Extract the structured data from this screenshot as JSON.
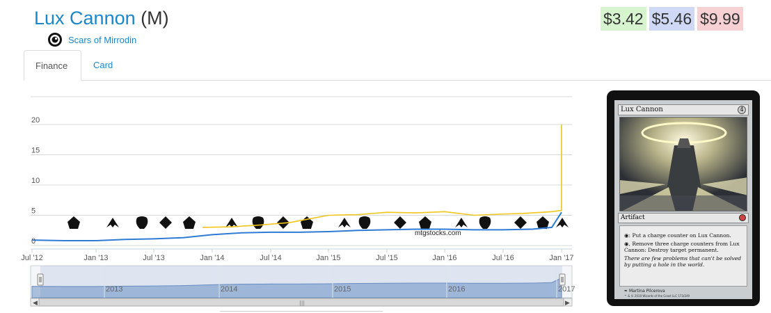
{
  "header": {
    "card_name": "Lux Cannon",
    "rarity": "(M)",
    "set_name": "Scars of Mirrodin",
    "set_icon": "scars-of-mirrodin-symbol"
  },
  "prices": {
    "low": "$3.42",
    "avg": "$5.46",
    "high": "$9.99",
    "colors": {
      "low": "#d6f5cf",
      "avg": "#cfd9f5",
      "high": "#f6d0d2"
    }
  },
  "tabs": [
    {
      "label": "Finance",
      "active": true
    },
    {
      "label": "Card",
      "active": false
    }
  ],
  "chart_data": {
    "type": "line",
    "title": "",
    "xlabel": "",
    "ylabel": "",
    "ylim": [
      0,
      25
    ],
    "yticks": [
      "0",
      "5",
      "10",
      "15",
      "20"
    ],
    "xticks": [
      "Jul '12",
      "Jan '13",
      "Jul '13",
      "Jan '14",
      "Jul '14",
      "Jan '15",
      "Jul '15",
      "Jan '16",
      "Jul '16",
      "Jan '17"
    ],
    "grid": true,
    "watermark": "mtgstocks.com",
    "series": [
      {
        "color": "#f2c51a",
        "x": [
          "Dec '13",
          "Mar '14",
          "Jun '14",
          "Sep '14",
          "Nov '14",
          "Jan '15",
          "Apr '15",
          "Jul '15",
          "Oct '15",
          "Jan '16",
          "Apr '16",
          "Jul '16",
          "Sep '16",
          "Nov '16",
          "Dec '16",
          "Jan '17",
          "Jan '17"
        ],
        "values": [
          3.0,
          3.1,
          3.4,
          3.8,
          4.4,
          5.0,
          5.1,
          5.5,
          5.4,
          5.6,
          5.0,
          5.2,
          5.3,
          5.5,
          5.6,
          5.8,
          20.0
        ]
      },
      {
        "color": "#2e7bd6",
        "x": [
          "Jul '12",
          "Oct '12",
          "Jan '13",
          "Apr '13",
          "Jul '13",
          "Oct '13",
          "Jan '14",
          "Apr '14",
          "Jul '14",
          "Oct '14",
          "Jan '15",
          "Apr '15",
          "Jul '15",
          "Oct '15",
          "Jan '16",
          "Apr '16",
          "Jul '16",
          "Oct '16",
          "Dec '16",
          "Jan '17"
        ],
        "values": [
          0.9,
          0.8,
          0.8,
          1.0,
          1.1,
          1.3,
          1.8,
          2.1,
          2.2,
          2.2,
          2.3,
          2.5,
          2.6,
          2.7,
          2.7,
          2.6,
          2.6,
          2.7,
          3.0,
          5.5
        ]
      }
    ],
    "set_release_icons": [
      "scars-symbol",
      "dark-ascension-symbol",
      "avacyn-symbol",
      "m14-symbol",
      "theros-symbol",
      "born-of-the-gods-symbol",
      "journey-symbol",
      "m15-symbol",
      "khans-symbol",
      "fate-reforged-symbol",
      "dragons-symbol",
      "origins-symbol",
      "battle-for-zendikar-symbol",
      "oath-symbol",
      "shadows-symbol",
      "eldritch-symbol",
      "kaladesh-symbol",
      "aether-symbol"
    ],
    "navigator": {
      "labels": [
        "2013",
        "2014",
        "2015",
        "2016",
        "2017"
      ]
    }
  },
  "card_image": {
    "name": "Lux Cannon",
    "cost": "4",
    "type": "Artifact",
    "rules": [
      ": Put a charge counter on Lux Cannon.",
      ", Remove three charge counters from Lux Cannon: Destroy target permanent."
    ],
    "flavor": "There are few problems that can't be solved by putting a hole in the world.",
    "artist": "Martina Pilcerova",
    "footer": "™ & © 2010 Wizards of the Coast LLC 173/249"
  }
}
